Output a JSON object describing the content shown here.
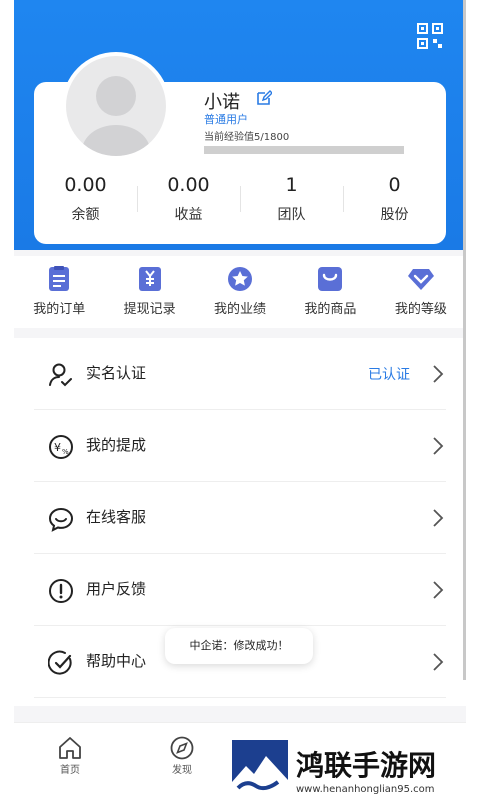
{
  "profile": {
    "name": "小诺",
    "role": "普通用户",
    "exp_text": "当前经验值5/1800",
    "exp_progress": 0.003
  },
  "stats": [
    {
      "value": "0.00",
      "label": "余额"
    },
    {
      "value": "0.00",
      "label": "收益"
    },
    {
      "value": "1",
      "label": "团队"
    },
    {
      "value": "0",
      "label": "股份"
    }
  ],
  "shortcuts": [
    {
      "label": "我的订单",
      "icon": "order-icon"
    },
    {
      "label": "提现记录",
      "icon": "withdraw-record-icon"
    },
    {
      "label": "我的业绩",
      "icon": "star-icon"
    },
    {
      "label": "我的商品",
      "icon": "bag-icon"
    },
    {
      "label": "我的等级",
      "icon": "diamond-icon"
    }
  ],
  "menu": [
    {
      "label": "实名认证",
      "value": "已认证",
      "icon": "user-verify-icon"
    },
    {
      "label": "我的提成",
      "value": "",
      "icon": "commission-icon"
    },
    {
      "label": "在线客服",
      "value": "",
      "icon": "chat-icon"
    },
    {
      "label": "用户反馈",
      "value": "",
      "icon": "feedback-icon"
    },
    {
      "label": "帮助中心",
      "value": "",
      "icon": "check-circle-icon"
    }
  ],
  "toast": "中企诺：修改成功！",
  "tabs": [
    {
      "label": "首页",
      "icon": "home-icon"
    },
    {
      "label": "发现",
      "icon": "compass-icon"
    }
  ],
  "watermark": {
    "title": "鸿联手游网",
    "url": "www.henanhonglian95.com"
  },
  "colors": {
    "brand_blue": "#1f86f0",
    "accent_text": "#2a7be4",
    "icon_purple": "#5a6fd6"
  }
}
